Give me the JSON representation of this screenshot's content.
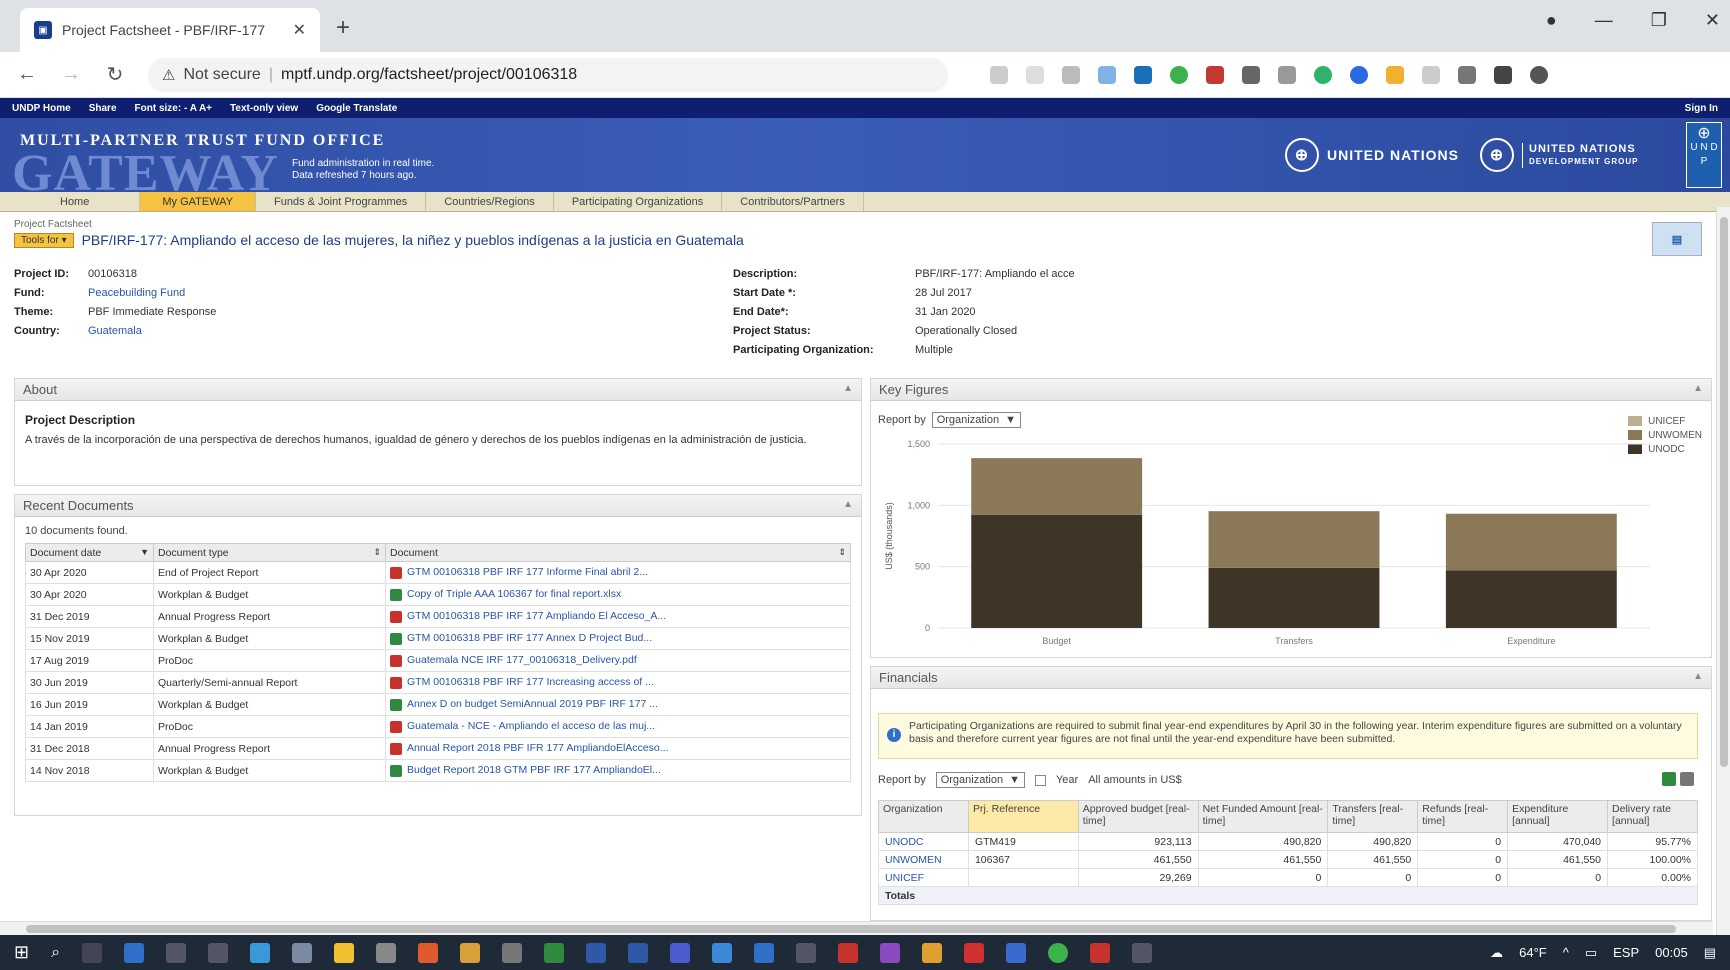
{
  "browser": {
    "tab_title": "Project Factsheet - PBF/IRF-177",
    "address_warning": "Not secure",
    "address_url": "mptf.undp.org/factsheet/project/00106318"
  },
  "undp_strip": {
    "items": [
      "UNDP Home",
      "Share",
      "Font size: - A A+",
      "Text-only view",
      "Google Translate"
    ],
    "right": [
      "Sign In"
    ]
  },
  "banner": {
    "office": "MULTI-PARTNER TRUST FUND OFFICE",
    "gateway": "GATEWAY",
    "sub1": "Fund administration in real time.",
    "sub2": "Data refreshed 7 hours ago.",
    "un": "UNITED NATIONS",
    "unsdg_1": "UNITED NATIONS",
    "unsdg_2": "DEVELOPMENT GROUP",
    "undp": "U N D P"
  },
  "sitenav": [
    "Home",
    "My GATEWAY",
    "Funds & Joint Programmes",
    "Countries/Regions",
    "Participating Organizations",
    "Contributors/Partners"
  ],
  "breadcrumb": "Project Factsheet",
  "tools_label": "Tools for ▾",
  "project_title": "PBF/IRF-177: Ampliando el acceso de las mujeres, la niñez y pueblos indígenas a la justicia en Guatemala",
  "meta_left": [
    {
      "k": "Project ID:",
      "v": "00106318",
      "link": false
    },
    {
      "k": "Fund:",
      "v": "Peacebuilding Fund",
      "link": true
    },
    {
      "k": "Theme:",
      "v": "PBF Immediate Response",
      "link": false
    },
    {
      "k": "Country:",
      "v": "Guatemala",
      "link": true
    }
  ],
  "meta_right": [
    {
      "k": "Description:",
      "v": "PBF/IRF-177: Ampliando el acce"
    },
    {
      "k": "Start Date *:",
      "v": "28 Jul 2017"
    },
    {
      "k": "End Date*:",
      "v": "31 Jan 2020"
    },
    {
      "k": "Project Status:",
      "v": "Operationally Closed"
    },
    {
      "k": "Participating Organization:",
      "v": "Multiple"
    }
  ],
  "about": {
    "header": "About",
    "heading": "Project Description",
    "text": "A través de la incorporación de una perspectiva de derechos humanos, igualdad de género y derechos de los pueblos indígenas en la administración de justicia."
  },
  "documents": {
    "header": "Recent Documents",
    "count": "10 documents found.",
    "columns": [
      "Document date",
      "Document type",
      "Document"
    ],
    "rows": [
      {
        "date": "30 Apr 2020",
        "type": "End of Project Report",
        "doc": "GTM 00106318 PBF IRF 177 Informe Final abril 2...",
        "ft": "pdf"
      },
      {
        "date": "30 Apr 2020",
        "type": "Workplan & Budget",
        "doc": "Copy of Triple AAA 106367 for final report.xlsx",
        "ft": "xls"
      },
      {
        "date": "31 Dec 2019",
        "type": "Annual Progress Report",
        "doc": "GTM 00106318 PBF IRF 177 Ampliando El Acceso_A...",
        "ft": "pdf"
      },
      {
        "date": "15 Nov 2019",
        "type": "Workplan & Budget",
        "doc": "GTM 00106318 PBF IRF 177 Annex D Project Bud...",
        "ft": "xls"
      },
      {
        "date": "17 Aug 2019",
        "type": "ProDoc",
        "doc": "Guatemala NCE IRF 177_00106318_Delivery.pdf",
        "ft": "pdf"
      },
      {
        "date": "30 Jun 2019",
        "type": "Quarterly/Semi-annual Report",
        "doc": "GTM 00106318 PBF IRF 177 Increasing access of ...",
        "ft": "pdf"
      },
      {
        "date": "16 Jun 2019",
        "type": "Workplan & Budget",
        "doc": "Annex D on budget SemiAnnual 2019 PBF IRF 177 ...",
        "ft": "xls"
      },
      {
        "date": "14 Jan 2019",
        "type": "ProDoc",
        "doc": "Guatemala - NCE - Ampliando el acceso de las muj...",
        "ft": "pdf"
      },
      {
        "date": "31 Dec 2018",
        "type": "Annual Progress Report",
        "doc": "Annual Report 2018 PBF IFR 177 AmpliandoElAcceso...",
        "ft": "pdf"
      },
      {
        "date": "14 Nov 2018",
        "type": "Workplan & Budget",
        "doc": "Budget Report 2018 GTM PBF IRF 177 AmpliandoEl...",
        "ft": "xls"
      }
    ]
  },
  "key_figures": {
    "header": "Key Figures",
    "report_by_label": "Report by",
    "report_by_value": "Organization"
  },
  "chart_data": {
    "type": "bar",
    "stacked": true,
    "categories": [
      "Budget",
      "Transfers",
      "Expenditure"
    ],
    "series": [
      {
        "name": "UNICEF",
        "color": "#bcae8e",
        "values": [
          0,
          0,
          0
        ]
      },
      {
        "name": "UNWOMEN",
        "color": "#8a7858",
        "values": [
          461550,
          461550,
          461550
        ]
      },
      {
        "name": "UNODC",
        "color": "#3f3428",
        "values": [
          923113,
          490820,
          470040
        ]
      }
    ],
    "ylabel": "US$ (thousands)",
    "yticks": [
      "0",
      "500",
      "1,000",
      "1,500"
    ],
    "ylim": [
      0,
      1500000
    ],
    "legend": "top-right",
    "grid": true
  },
  "financials": {
    "header": "Financials",
    "notice": "Participating Organizations are required to submit final year-end expenditures by April 30 in the following year. Interim expenditure figures are submitted on a voluntary basis and therefore current year figures are not final until the year-end expenditure have been submitted.",
    "report_by_label": "Report by",
    "report_by_value": "Organization",
    "year_label": "Year",
    "amounts_label": "All amounts in US$",
    "columns": [
      "Organization",
      "Prj. Reference",
      "Approved budget [real-time]",
      "Net Funded Amount [real-time]",
      "Transfers [real-time]",
      "Refunds [real-time]",
      "Expenditure [annual]",
      "Delivery rate [annual]"
    ],
    "rows": [
      {
        "org": "UNODC",
        "ref": "GTM419",
        "budget": "923,113",
        "net": "490,820",
        "transfers": "490,820",
        "refunds": "0",
        "exp": "470,040",
        "rate": "95.77%"
      },
      {
        "org": "UNWOMEN",
        "ref": "106367",
        "budget": "461,550",
        "net": "461,550",
        "transfers": "461,550",
        "refunds": "0",
        "exp": "461,550",
        "rate": "100.00%"
      },
      {
        "org": "UNICEF",
        "ref": "",
        "budget": "29,269",
        "net": "0",
        "transfers": "0",
        "refunds": "0",
        "exp": "0",
        "rate": "0.00%"
      }
    ],
    "totals_label": "Totals"
  },
  "taskbar": {
    "temp": "64°F",
    "lang": "ESP",
    "time": "00:05"
  }
}
